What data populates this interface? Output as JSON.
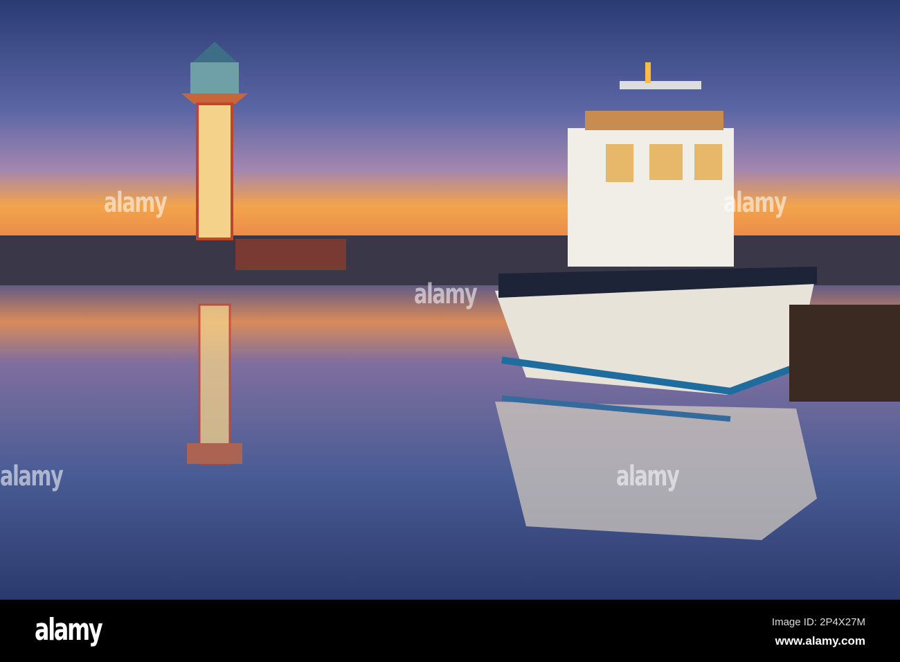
{
  "watermark": {
    "text": "alamy"
  },
  "footer": {
    "logo": "alamy",
    "image_id": "Image ID: 2P4X27M",
    "website": "www.alamy.com"
  },
  "colors": {
    "sky_top": "#2c3f78",
    "sky_mid": "#7a6fa8",
    "horizon": "#f5a640",
    "water": "#3d4b7e"
  }
}
